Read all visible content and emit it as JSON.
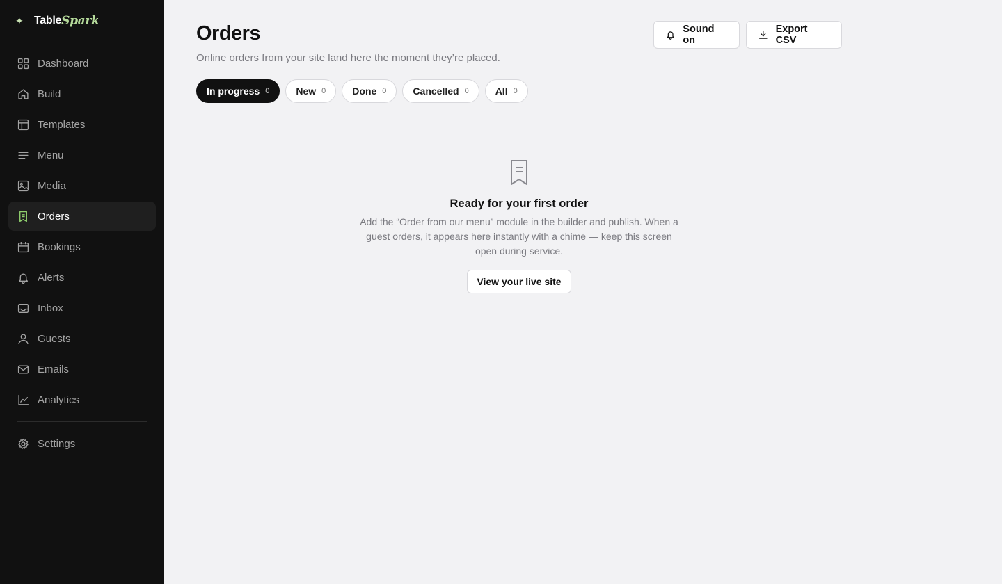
{
  "brand": {
    "name_part1": "Table",
    "name_part2": "Spark",
    "accent": "#b7dc9c"
  },
  "sidebar": {
    "items": [
      {
        "label": "Dashboard",
        "icon": "grid-icon"
      },
      {
        "label": "Build",
        "icon": "home-icon"
      },
      {
        "label": "Templates",
        "icon": "layout-icon"
      },
      {
        "label": "Menu",
        "icon": "lines-icon"
      },
      {
        "label": "Media",
        "icon": "image-icon"
      },
      {
        "label": "Orders",
        "icon": "receipt-icon",
        "active": true
      },
      {
        "label": "Bookings",
        "icon": "calendar-icon"
      },
      {
        "label": "Alerts",
        "icon": "bell-icon"
      },
      {
        "label": "Inbox",
        "icon": "inbox-icon"
      },
      {
        "label": "Guests",
        "icon": "user-icon"
      },
      {
        "label": "Emails",
        "icon": "mail-icon"
      },
      {
        "label": "Analytics",
        "icon": "chart-icon"
      }
    ],
    "settings": {
      "label": "Settings",
      "icon": "gear-icon"
    }
  },
  "header": {
    "title": "Orders",
    "subtitle": "Online orders from your site land here the moment they’re placed.",
    "sound_label": "Sound on",
    "export_label": "Export CSV"
  },
  "tabs": [
    {
      "label": "In progress",
      "count": "0",
      "active": true
    },
    {
      "label": "New",
      "count": "0"
    },
    {
      "label": "Done",
      "count": "0"
    },
    {
      "label": "Cancelled",
      "count": "0"
    },
    {
      "label": "All",
      "count": "0"
    }
  ],
  "empty_state": {
    "title": "Ready for your first order",
    "description": "Add the “Order from our menu” module in the builder and publish. When a guest orders, it appears here instantly with a chime — keep this screen open during service.",
    "button_label": "View your live site"
  }
}
